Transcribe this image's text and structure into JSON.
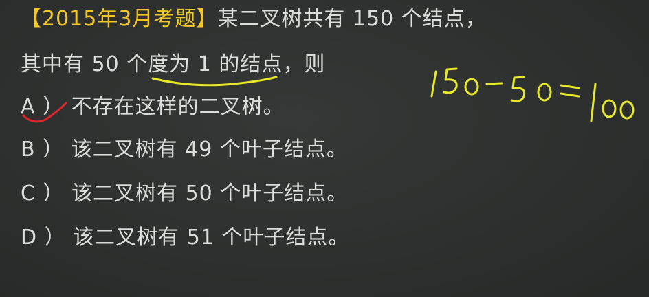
{
  "question": {
    "tag": "【2015年3月考题】",
    "stem_line1": "某二叉树共有 150 个结点，",
    "stem_line2": "其中有 50 个度为 1 的结点，则"
  },
  "options": [
    {
      "letter": "A",
      "text": "不存在这样的二叉树。"
    },
    {
      "letter": "B",
      "text": "该二叉树有 49 个叶子结点。"
    },
    {
      "letter": "C",
      "text": "该二叉树有 50 个叶子结点。"
    },
    {
      "letter": "D",
      "text": "该二叉树有 51 个叶子结点。"
    }
  ],
  "handwriting": {
    "note": "150-50=100"
  },
  "colors": {
    "background": "#2b2e2c",
    "text": "#dcdedc",
    "tag": "#f3c629",
    "ink_yellow": "#e7e82a",
    "ink_red": "#e0262a"
  }
}
